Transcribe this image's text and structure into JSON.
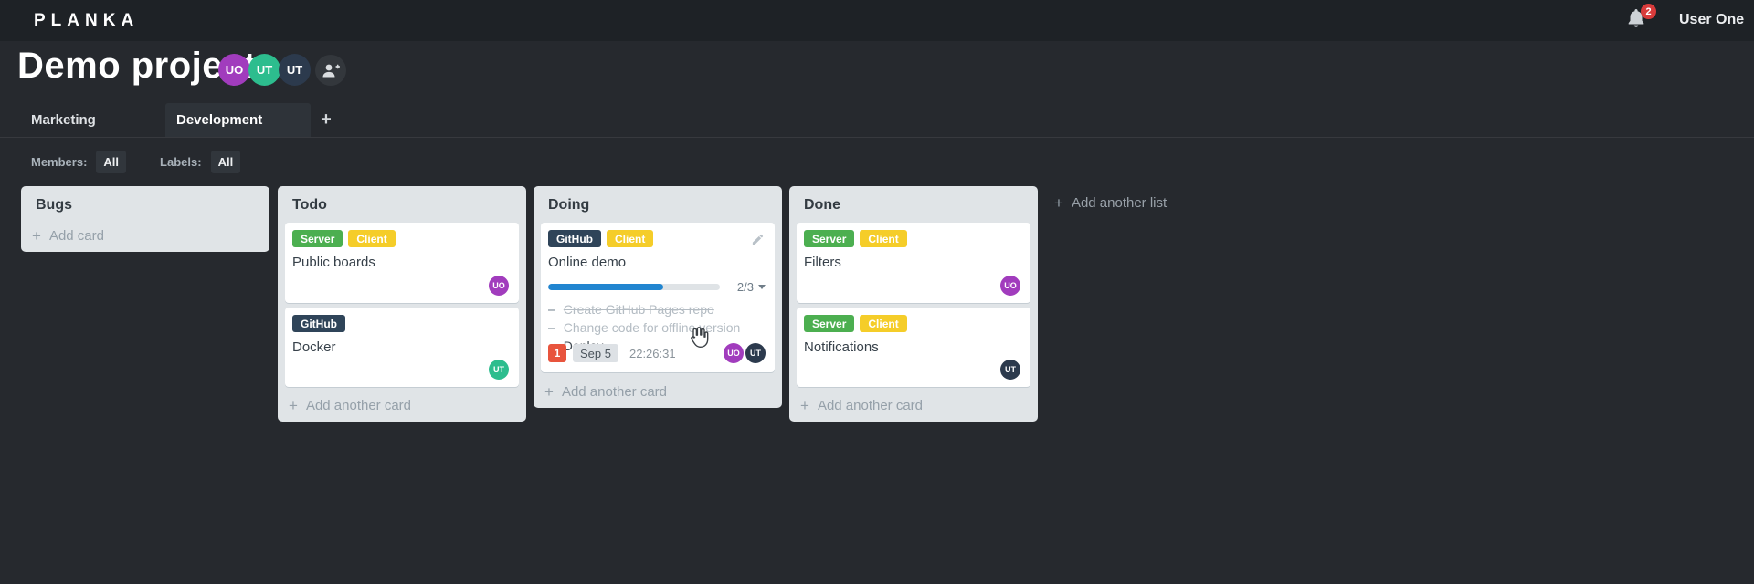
{
  "header": {
    "logo": "PLANKA",
    "notification_count": "2",
    "user_name": "User One"
  },
  "project": {
    "title": "Demo project",
    "members": [
      {
        "initials": "UO",
        "color": "#a13cbd"
      },
      {
        "initials": "UT",
        "color": "#2dbd8e"
      },
      {
        "initials": "UT",
        "color": "#2c3a4d"
      }
    ]
  },
  "tabs": {
    "items": [
      {
        "label": "Marketing"
      },
      {
        "label": "Development"
      }
    ],
    "add_label": "+"
  },
  "filters": {
    "members_label": "Members:",
    "members_value": "All",
    "labels_label": "Labels:",
    "labels_value": "All"
  },
  "icons": {
    "plus": "+"
  },
  "colors": {
    "progress_blue": "#2185d0",
    "due_red": "#e8543d",
    "label_green": "#4caf50",
    "label_yellow": "#f5cd29",
    "label_navy": "#2f4459"
  },
  "board": {
    "add_list_label": "Add another list",
    "lists": [
      {
        "name": "Bugs",
        "add_label": "Add card",
        "cards": []
      },
      {
        "name": "Todo",
        "add_label": "Add another card",
        "cards": [
          {
            "title": "Public boards",
            "labels": [
              {
                "text": "Server",
                "color": "#4caf50"
              },
              {
                "text": "Client",
                "color": "#f5cd29"
              }
            ],
            "assignee": {
              "initials": "UO",
              "color": "#a13cbd"
            }
          },
          {
            "title": "Docker",
            "labels": [
              {
                "text": "GitHub",
                "color": "#2f4459"
              }
            ],
            "assignee": {
              "initials": "UT",
              "color": "#2dbd8e"
            }
          }
        ]
      },
      {
        "name": "Doing",
        "add_label": "Add another card",
        "cards": [
          {
            "title": "Online demo",
            "labels": [
              {
                "text": "GitHub",
                "color": "#2f4459"
              },
              {
                "text": "Client",
                "color": "#f5cd29"
              }
            ],
            "progress": {
              "text": "2/3",
              "percent": "67%",
              "color": "#2185d0"
            },
            "tasks": [
              {
                "text": "Create GitHub Pages repo",
                "done": true
              },
              {
                "text": "Change code for offline version",
                "done": true
              },
              {
                "text": "Deploy",
                "done": false
              }
            ],
            "due": {
              "count": "1",
              "date": "Sep 5",
              "time": "22:26:31",
              "color": "#e8543d"
            },
            "assignees": [
              {
                "initials": "UO",
                "color": "#a13cbd"
              },
              {
                "initials": "UT",
                "color": "#2c3a4d"
              }
            ]
          }
        ]
      },
      {
        "name": "Done",
        "add_label": "Add another card",
        "cards": [
          {
            "title": "Filters",
            "labels": [
              {
                "text": "Server",
                "color": "#4caf50"
              },
              {
                "text": "Client",
                "color": "#f5cd29"
              }
            ],
            "assignee": {
              "initials": "UO",
              "color": "#a13cbd"
            }
          },
          {
            "title": "Notifications",
            "labels": [
              {
                "text": "Server",
                "color": "#4caf50"
              },
              {
                "text": "Client",
                "color": "#f5cd29"
              }
            ],
            "assignee": {
              "initials": "UT",
              "color": "#2c3a4d"
            }
          }
        ]
      }
    ]
  }
}
